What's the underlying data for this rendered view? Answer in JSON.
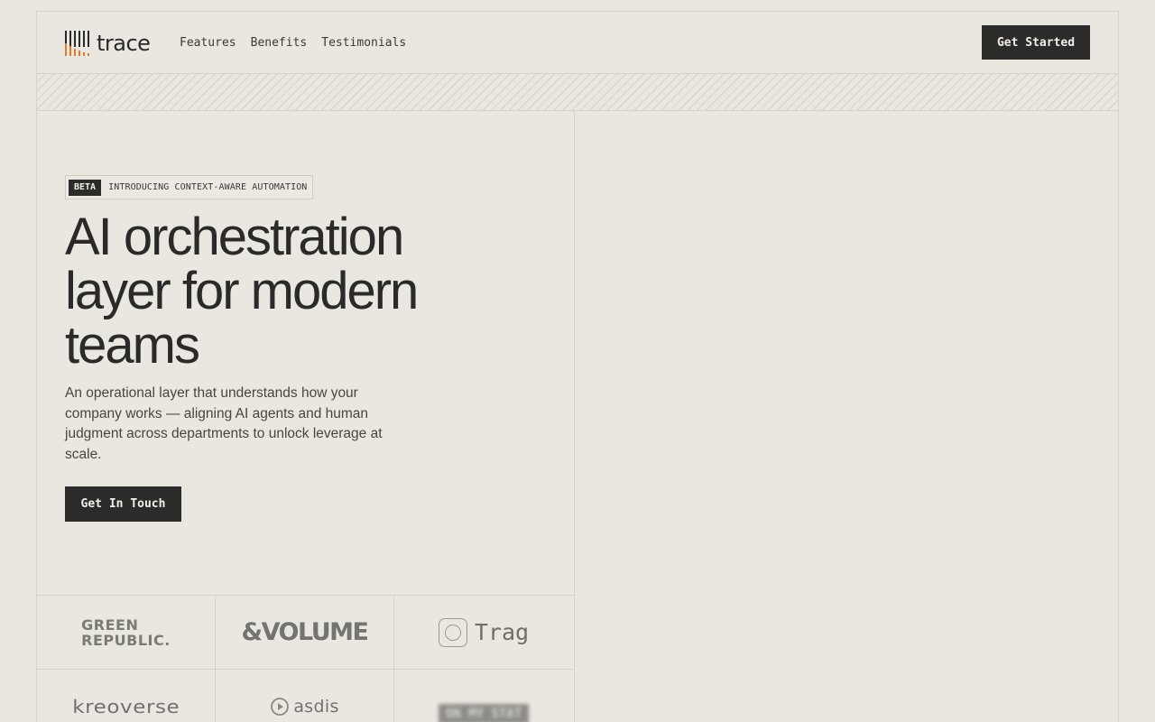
{
  "brand": {
    "name": "trace",
    "accent": "#e07a2c"
  },
  "nav": {
    "items": [
      {
        "label": "Features"
      },
      {
        "label": "Benefits"
      },
      {
        "label": "Testimonials"
      }
    ],
    "cta_label": "Get Started"
  },
  "hero": {
    "badge_tag": "BETA",
    "badge_text": "INTRODUCING CONTEXT-AWARE AUTOMATION",
    "headline": "AI orchestration layer for modern teams",
    "subcopy": "An operational layer that understands how your company works — aligning AI agents and human judgment across departments to unlock leverage at scale.",
    "cta_label": "Get In Touch"
  },
  "logos": {
    "green_republic": [
      "GREEN",
      "REPUBLIC."
    ],
    "volume": "&VOLUME",
    "trag": "Trag",
    "kreoverse": "kreoverse",
    "asdis": "asdis",
    "blurred": "ON MY STAT"
  },
  "colors": {
    "background": "#e9e7df",
    "text": "#2a2a28",
    "button": "#2b2b29",
    "border": "#d6d3ca"
  }
}
